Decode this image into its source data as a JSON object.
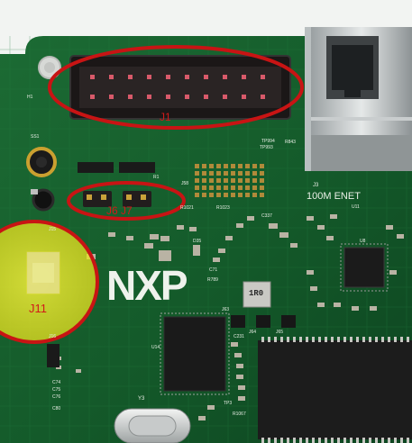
{
  "image": {
    "subject": "Green NXP development board, close-up of the upper left corner",
    "colors": {
      "pcb_green": "#145a2a",
      "pcb_dark": "#0f3d1f",
      "annotation_red": "#c81414",
      "highlight_yellow": "#f2ef2a",
      "silkscreen": "#e9efe6"
    }
  },
  "annotations": {
    "j1": {
      "label": "J1"
    },
    "j6_j7": {
      "label": "J6  J7"
    },
    "j11": {
      "label": "J11"
    }
  },
  "silkscreen": {
    "logo": "NXP",
    "ethernet": "100M ENET",
    "ref_j3": "J3",
    "ref_y3": "Y3",
    "ref_u14": "U14",
    "ref_ss1": "SS1",
    "ref_h1": "H1",
    "ref_j63": "J63",
    "ref_j64": "J64",
    "ref_j65": "J65",
    "ref_j16": "J16",
    "ref_d35": "D35",
    "ref_r843": "R843",
    "ref_tp994": "TP994",
    "ref_tp993": "TP993",
    "ref_c337": "C337",
    "ref_c231": "C231",
    "ref_r1067": "R1067",
    "ref_c71": "C71",
    "ref_r789": "R789",
    "ref_u11": "U11",
    "ref_u8": "U8",
    "ref_c74": "C74",
    "ref_c75": "C75",
    "ref_c76": "C76",
    "ref_r1021": "R1021",
    "ref_r1023": "R1023",
    "ref_j58": "J58",
    "ref_tp3": "TP3",
    "ref_j15": "J15",
    "ref_c80": "C80",
    "ref_r1": "R1"
  },
  "chip_markings": {
    "inductor": "1R0"
  }
}
